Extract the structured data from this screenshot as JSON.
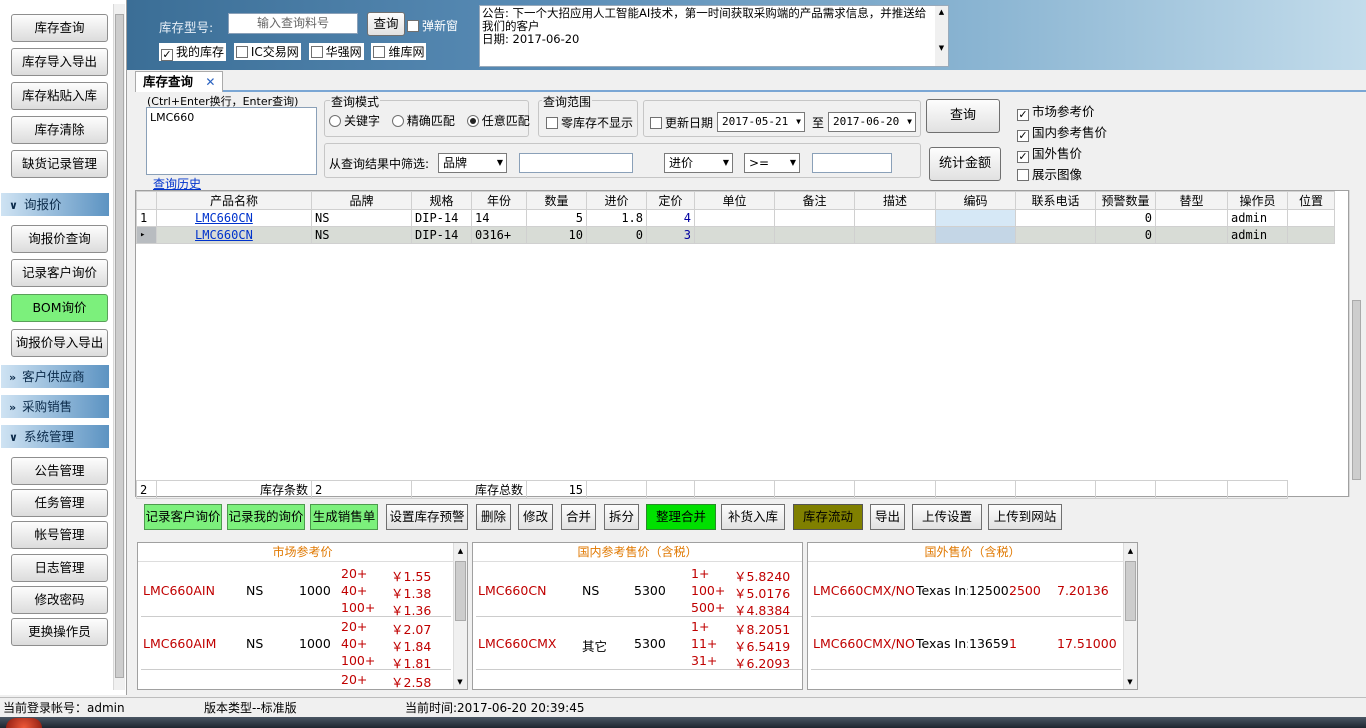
{
  "sidebar": {
    "top_buttons": [
      "库存查询",
      "库存导入导出",
      "库存粘贴入库",
      "库存清除",
      "缺货记录管理"
    ],
    "section_inquiry": "询报价",
    "inquiry_buttons": [
      "询报价查询",
      "记录客户询价",
      "BOM询价",
      "询报价导入导出"
    ],
    "section_customer": "客户供应商",
    "section_purchase": "采购销售",
    "section_system": "系统管理",
    "system_buttons": [
      "公告管理",
      "任务管理",
      "帐号管理",
      "日志管理",
      "修改密码",
      "更换操作员"
    ]
  },
  "banner": {
    "stock_model_label": "库存型号:",
    "search_placeholder": "输入查询料号",
    "query_button": "查询",
    "popup_label": "弹新窗",
    "sites": [
      "我的库存",
      "IC交易网",
      "华强网",
      "维库网"
    ],
    "notice": "公告: 下一个大招应用人工智能AI技术，第一时间获取采购端的产品需求信息，并推送给我们的客户",
    "notice_date": "日期: 2017-06-20"
  },
  "tab": {
    "label": "库存查询",
    "close": "✕"
  },
  "query": {
    "hint": "(Ctrl+Enter换行，Enter查询)",
    "text": "LMC660",
    "history_link": "查询历史",
    "mode_title": "查询模式",
    "modes": [
      "关键字",
      "精确匹配",
      "任意匹配"
    ],
    "range_title": "查询范围",
    "zero_stock": "零库存不显示",
    "update_date": "更新日期",
    "date_from": "2017-05-21",
    "date_to_label": "至",
    "date_to": "2017-06-20",
    "query_button": "查询",
    "filter_label": "从查询结果中筛选:",
    "filter_field": "品牌",
    "filter_field2": "进价",
    "filter_op": ">=",
    "sum_button": "统计金额",
    "checks": [
      "市场参考价",
      "国内参考售价",
      "国外售价",
      "展示图像"
    ]
  },
  "grid": {
    "columns": [
      "产品名称",
      "品牌",
      "规格",
      "年份",
      "数量",
      "进价",
      "定价",
      "单位",
      "备注",
      "描述",
      "编码",
      "联系电话",
      "预警数量",
      "替型",
      "操作员",
      "位置"
    ],
    "rows": [
      {
        "idx": "1",
        "name": "LMC660CN",
        "brand": "NS",
        "spec": "DIP-14",
        "year": "14",
        "qty": "5",
        "cost": "1.8",
        "price": "4",
        "warn": "0",
        "op": "admin"
      },
      {
        "idx": "",
        "name": "LMC660CN",
        "brand": "NS",
        "spec": "DIP-14",
        "year": "0316+",
        "qty": "10",
        "cost": "0",
        "price": "3",
        "warn": "0",
        "op": "admin"
      }
    ],
    "footer": {
      "idx": "2",
      "count_label": "库存条数",
      "count": "2",
      "total_label": "库存总数",
      "total": "15"
    }
  },
  "actions": [
    "记录客户询价",
    "记录我的询价",
    "生成销售单",
    "设置库存预警",
    "删除",
    "修改",
    "合并",
    "拆分",
    "整理合并",
    "补货入库",
    "库存流动",
    "导出",
    "上传设置",
    "上传到网站"
  ],
  "panels": {
    "market": {
      "title": "市场参考价",
      "rows": [
        {
          "part": "LMC660AIN",
          "brand": "NS",
          "qty": "1000",
          "tiers": [
            "20+",
            "40+",
            "100+"
          ],
          "prices": [
            "￥1.55",
            "￥1.38",
            "￥1.36"
          ]
        },
        {
          "part": "LMC660AIM",
          "brand": "NS",
          "qty": "1000",
          "tiers": [
            "20+",
            "40+",
            "100+"
          ],
          "prices": [
            "￥2.07",
            "￥1.84",
            "￥1.81"
          ]
        },
        {
          "part": "",
          "brand": "",
          "qty": "",
          "tiers": [
            "20+"
          ],
          "prices": [
            "￥2.58"
          ]
        }
      ]
    },
    "domestic": {
      "title": "国内参考售价（含税）",
      "rows": [
        {
          "part": "LMC660CN",
          "brand": "NS",
          "qty": "5300",
          "tiers": [
            "1+",
            "100+",
            "500+"
          ],
          "prices": [
            "￥5.8240",
            "￥5.0176",
            "￥4.8384"
          ]
        },
        {
          "part": "LMC660CMX",
          "brand": "其它",
          "qty": "5300",
          "tiers": [
            "1+",
            "11+",
            "31+"
          ],
          "prices": [
            "￥8.2051",
            "￥6.5419",
            "￥6.2093"
          ]
        }
      ]
    },
    "foreign": {
      "title": "国外售价（含税）",
      "rows": [
        {
          "part": "LMC660CMX/NO",
          "brand": "Texas In:",
          "qty": "12500",
          "moq": "2500",
          "price": "7.20136"
        },
        {
          "part": "LMC660CMX/NO",
          "brand": "Texas In:",
          "qty": "13659",
          "moq": "1",
          "price": "17.51000"
        }
      ]
    }
  },
  "status": {
    "account": "当前登录帐号：admin",
    "version": "版本类型--标准版",
    "time": "当前时间:2017-06-20 20:39:45"
  }
}
